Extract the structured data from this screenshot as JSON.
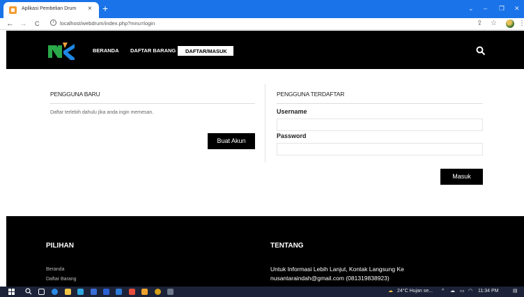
{
  "browser": {
    "tab_title": "Aplikasi Pembelian Drum",
    "tab_close": "×",
    "new_tab": "+",
    "window_controls": {
      "minimize": "–",
      "maximize": "❐",
      "close": "✕",
      "chevron": "⌄"
    },
    "nav": {
      "back": "←",
      "forward": "→",
      "reload": "C"
    },
    "url": "localhost/webdrum/index.php?mnu=login",
    "toolbar_icons": {
      "share": "⇪",
      "bookmark": "☆",
      "menu": "⋮"
    }
  },
  "header": {
    "nav_items": [
      "BERANDA",
      "DAFTAR BARANG"
    ],
    "active_item": "DAFTAR/MASUK"
  },
  "new_user": {
    "title": "PENGGUNA BARU",
    "description": "Daftar terlebih dahulu jika anda ingin memesan.",
    "create_button": "Buat Akun"
  },
  "registered_user": {
    "title": "PENGGUNA TERDAFTAR",
    "username_label": "Username",
    "username_value": "",
    "password_label": "Password",
    "password_value": "",
    "login_button": "Masuk"
  },
  "footer": {
    "options_title": "PILIHAN",
    "options_links": [
      "Beranda",
      "Daftar Barang"
    ],
    "about_title": "TENTANG",
    "about_line1": "Untuk Informasi Lebih Lanjut, Kontak Langsung Ke",
    "about_line2": "nusantaraindah@gmail.com (081319838923)"
  },
  "taskbar": {
    "weather": "24°C  Hujan se...",
    "tray_symbols": "^",
    "time": "11:34 PM"
  },
  "colors": {
    "chrome_blue": "#1a73e8",
    "site_black": "#000000",
    "taskbar": "#1c2338"
  }
}
